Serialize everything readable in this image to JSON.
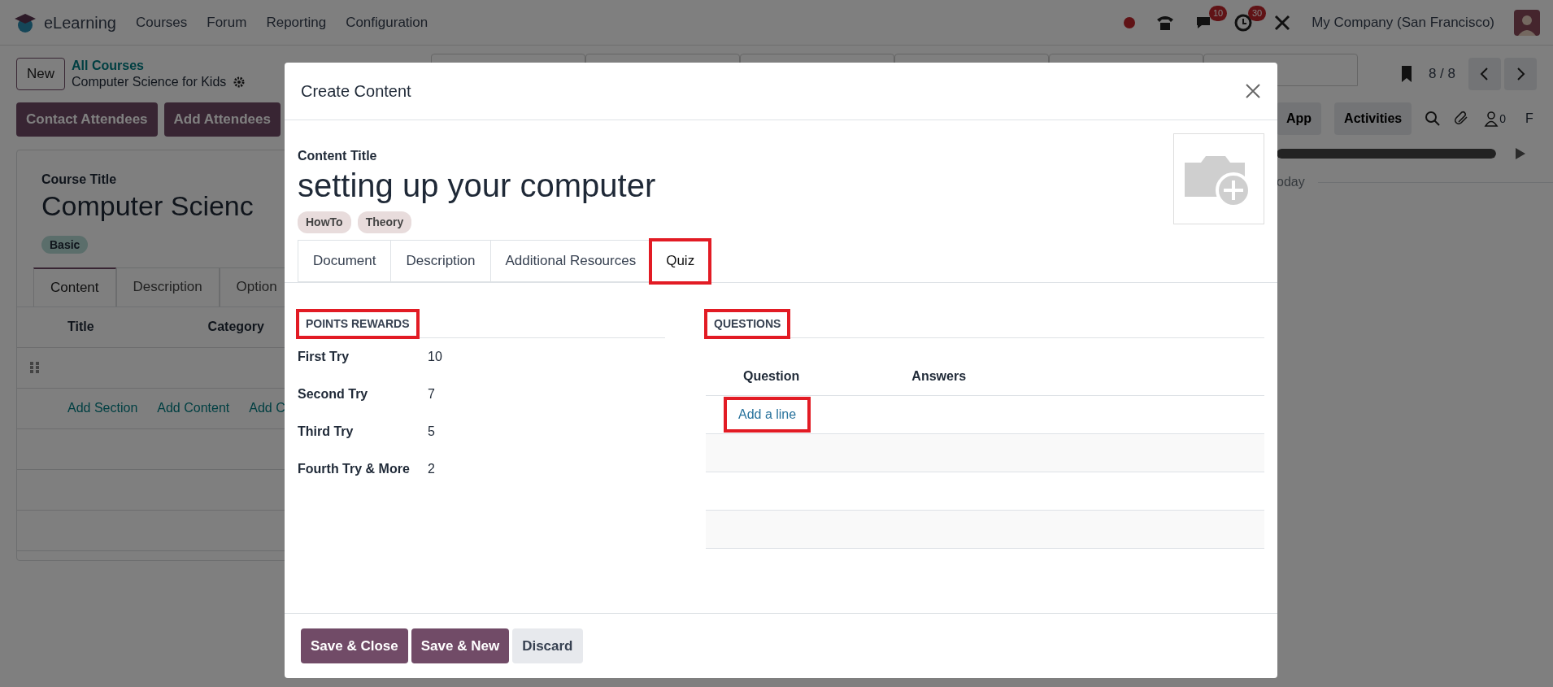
{
  "navbar": {
    "app_name": "eLearning",
    "menus": [
      "Courses",
      "Forum",
      "Reporting",
      "Configuration"
    ],
    "chat_badge": "10",
    "activity_badge": "30",
    "company": "My Company (San Francisco)"
  },
  "control_panel": {
    "new_button": "New",
    "breadcrumb_parent": "All Courses",
    "breadcrumb_current": "Computer Science for Kids",
    "pager": "8 / 8"
  },
  "actions": [
    "Contact Attendees",
    "Add Attendees"
  ],
  "form": {
    "title_label": "Course Title",
    "title": "Computer Scienc",
    "tags": [
      "Basic"
    ],
    "tabs": [
      {
        "label": "Content",
        "selected": true
      },
      {
        "label": "Description",
        "selected": false
      },
      {
        "label": "Option",
        "selected": false
      }
    ],
    "columns": [
      "Title",
      "Category"
    ],
    "links": [
      "Add Section",
      "Add Content",
      "Add C"
    ]
  },
  "chatter": {
    "progress": {
      "level": 1
    },
    "buttons": [
      "App",
      "Activities"
    ],
    "followers": "0",
    "follow": "F",
    "date_separator": "oday"
  },
  "modal": {
    "title": "Create Content",
    "content_label": "Content Title",
    "content_title": "setting up your computer",
    "tags": [
      "HowTo",
      "Theory"
    ],
    "tabs": [
      {
        "label": "Document",
        "selected": false,
        "highlighted": false
      },
      {
        "label": "Description",
        "selected": false,
        "highlighted": false
      },
      {
        "label": "Additional Resources",
        "selected": false,
        "highlighted": false
      },
      {
        "label": "Quiz",
        "selected": true,
        "highlighted": true
      }
    ],
    "points": {
      "title": "POINTS REWARDS",
      "highlighted": true,
      "rows": [
        {
          "label": "First Try",
          "value": "10"
        },
        {
          "label": "Second Try",
          "value": "7"
        },
        {
          "label": "Third Try",
          "value": "5"
        },
        {
          "label": "Fourth Try & More",
          "value": "2"
        }
      ]
    },
    "questions": {
      "title": "QUESTIONS",
      "highlighted": true,
      "columns": [
        "Question",
        "Answers"
      ],
      "add_line": {
        "label": "Add a line",
        "highlighted": true
      }
    },
    "buttons": [
      {
        "label": "Save & Close",
        "kind": "primary"
      },
      {
        "label": "Save & New",
        "kind": "primary"
      },
      {
        "label": "Discard",
        "kind": "secondary"
      }
    ]
  }
}
